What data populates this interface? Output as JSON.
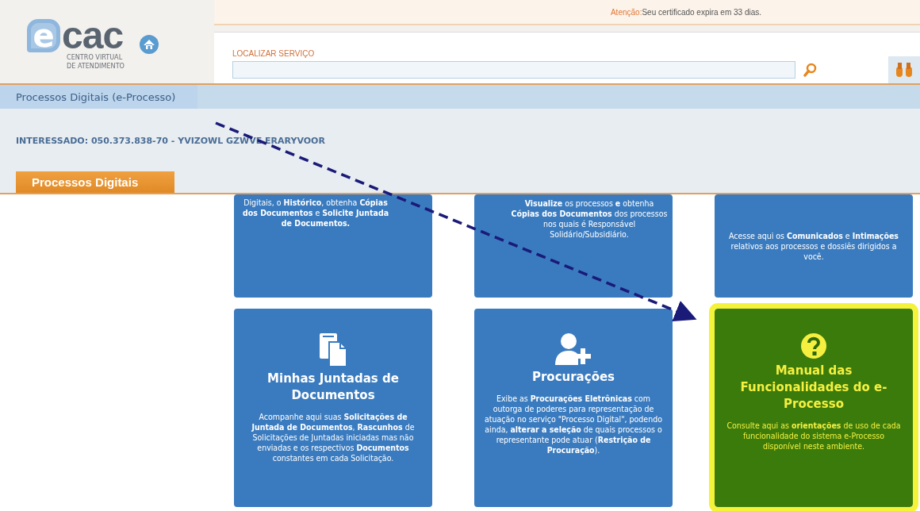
{
  "header": {
    "logo": {
      "mark": "e",
      "name": "cac",
      "tagline": [
        "CENTRO VIRTUAL",
        "DE ATENDIMENTO"
      ]
    },
    "alert": {
      "label": "Atenção:",
      "message": "Seu certificado expira em 33 dias."
    },
    "search": {
      "label": "LOCALIZAR SERVIÇO"
    }
  },
  "breadcrumb": "Processos Digitais (e-Processo)",
  "interested": "INTERESSADO: 050.373.838-70 - YVIZOWL GZWVE ERARYVOOR",
  "section_tab": "Processos Digitais",
  "cards": [
    {
      "kind": "text",
      "highlighted": false,
      "description": "Digitais, o **Histórico**, obtenha **Cópias dos Documentos** e **Solicite Juntada de Documentos.**"
    },
    {
      "kind": "text",
      "highlighted": false,
      "description": "**Visualize** os processos **e** obtenha **Cópias dos Documentos** dos processos nos quais é Responsável Solidário/Subsidiário."
    },
    {
      "kind": "text",
      "highlighted": false,
      "description": "Acesse aqui os **Comunicados** e **Intimações** relativos aos processos e dossiês dirigidos a você."
    },
    {
      "kind": "documents",
      "highlighted": false,
      "title": "Minhas Juntadas de Documentos",
      "description": "Acompanhe aqui suas **Solicitações de Juntada de Documentos**, **Rascunhos** de Solicitações de Juntadas iniciadas mas não enviadas e os respectivos **Documentos** constantes em cada Solicitação."
    },
    {
      "kind": "proxy",
      "highlighted": false,
      "title": "Procurações",
      "description": "Exibe as **Procurações Eletrônicas** com outorga de poderes para representação de atuação no serviço \"Processo Digital\", podendo ainda, **alterar a seleção** de quais processos o representante pode atuar (**Restrição de Procuração**)."
    },
    {
      "kind": "help",
      "highlighted": true,
      "title": "Manual das Funcionalidades do e-Processo",
      "description": "Consulte aqui as **orientações** de uso de cada funcionalidade do sistema e-Processo disponível neste ambiente."
    }
  ]
}
